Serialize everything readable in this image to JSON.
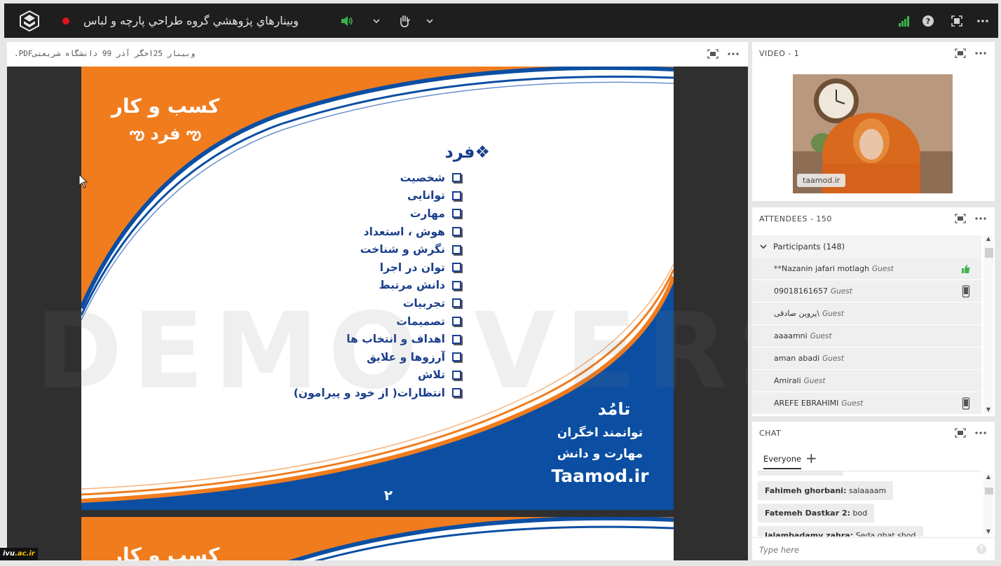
{
  "topbar": {
    "meeting_title": "وبينارهاي پژوهشي گروه طراحي پارچه و لباس",
    "icons": [
      "app-logo-icon",
      "recording-indicator-icon",
      "speaker-icon",
      "chevron-down-icon",
      "raise-hand-icon",
      "chevron-down-icon",
      "connection-bars-icon",
      "help-icon",
      "fullscreen-icon",
      "more-icon"
    ],
    "record_color": "#e0121b",
    "signal_color": "#3ab44a"
  },
  "share_pod": {
    "title": ".PDFوبينار 25اخگر  آذر 99 دانشگاه شريعتی"
  },
  "slide": {
    "title_line1": "کسب و کار",
    "title_line2": "ఌ فرد ఌ",
    "list_heading": "❖فرد",
    "items": [
      "شخصیت",
      "توانایی",
      "مهارت",
      "هوش ، استعداد",
      "نگرش و شناخت",
      "توان در اجرا",
      "دانش مرتبط",
      "تجربیات",
      "تصمیمات",
      "اهداف  و انتخاب ها",
      "آرزوها و علایق",
      "تلاش",
      "انتظارات( از خود و پیرامون)"
    ],
    "brand_name": "تامُد",
    "brand_line1": "توانمند اخگران",
    "brand_line2": "مهارت و دانش",
    "brand_url": "Taamod.ir",
    "page_number": "۲",
    "next_slide_title": "کسب و کار",
    "colors": {
      "orange": "#f07c1e",
      "blue": "#0b4ea2",
      "text_blue": "#1a3e8c"
    }
  },
  "watermark": "DEMO VERSION",
  "video_pod": {
    "title": "VIDEO  - 1",
    "name_tag": "taamod.ir"
  },
  "attendees_pod": {
    "title": "ATTENDEES  - 150",
    "group_label": "Participants (148)",
    "rows": [
      {
        "name": "**Nazanin jafari motlagh",
        "role": "Guest",
        "status": "thumbs-up-icon"
      },
      {
        "name": "09018161657",
        "role": "Guest",
        "status": "mobile-device-icon"
      },
      {
        "name": "پروین صادقی\\",
        "role": "Guest",
        "status": ""
      },
      {
        "name": "aaaamni",
        "role": "Guest",
        "status": ""
      },
      {
        "name": "aman abadi",
        "role": "Guest",
        "status": ""
      },
      {
        "name": "Amirali",
        "role": "Guest",
        "status": ""
      },
      {
        "name": "AREFE EBRAHIMI",
        "role": "Guest",
        "status": "mobile-device-icon"
      }
    ],
    "status_color": "#3ab44a"
  },
  "chat_pod": {
    "title": "CHAT",
    "tab": "Everyone",
    "add_tab": "+",
    "messages": [
      {
        "author": "Fahimeh ghorbani:",
        "text": "salaaaam"
      },
      {
        "author": "Fatemeh Dastkar 2:",
        "text": "bod"
      },
      {
        "author": "Jalambadamy zahra:",
        "text": "Seda ghat shod"
      }
    ],
    "input_placeholder": "Type here"
  },
  "badge": {
    "prefix": "ivu",
    "suffix": ".ac.ir"
  }
}
